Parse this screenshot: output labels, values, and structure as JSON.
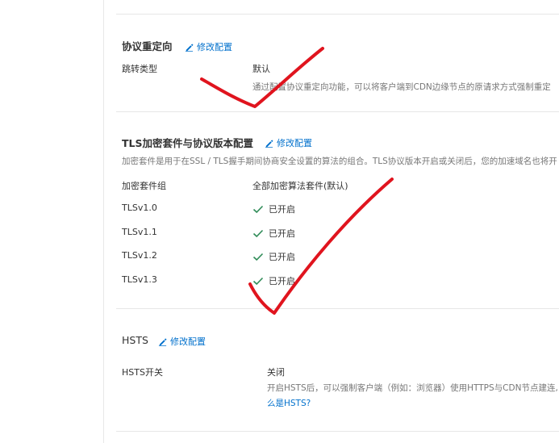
{
  "redirect": {
    "title": "协议重定向",
    "edit_label": "修改配置",
    "jump_type_label": "跳转类型",
    "jump_type_value": "默认",
    "desc": "通过配置协议重定向功能，可以将客户端到CDN边缘节点的原请求方式强制重定"
  },
  "tls": {
    "title": "TLS加密套件与协议版本配置",
    "edit_label": "修改配置",
    "desc": "加密套件是用于在SSL / TLS握手期间协商安全设置的算法的组合。TLS协议版本开启或关闭后，您的加速域名也将开",
    "suite_label": "加密套件组",
    "suite_value": "全部加密算法套件(默认)",
    "versions": [
      {
        "name": "TLSv1.0",
        "status": "已开启"
      },
      {
        "name": "TLSv1.1",
        "status": "已开启"
      },
      {
        "name": "TLSv1.2",
        "status": "已开启"
      },
      {
        "name": "TLSv1.3",
        "status": "已开启"
      }
    ]
  },
  "hsts": {
    "title": "HSTS",
    "edit_label": "修改配置",
    "switch_label": "HSTS开关",
    "switch_value": "关闭",
    "desc": "开启HSTS后，可以强制客户端（例如：浏览器）使用HTTPS与CDN节点建连,",
    "link": "么是HSTS?"
  },
  "colors": {
    "link": "#0070cc",
    "check": "#2e8b57",
    "annotation": "#e0141e"
  },
  "icons": {
    "edit": "pencil-icon",
    "enabled": "check-icon"
  }
}
